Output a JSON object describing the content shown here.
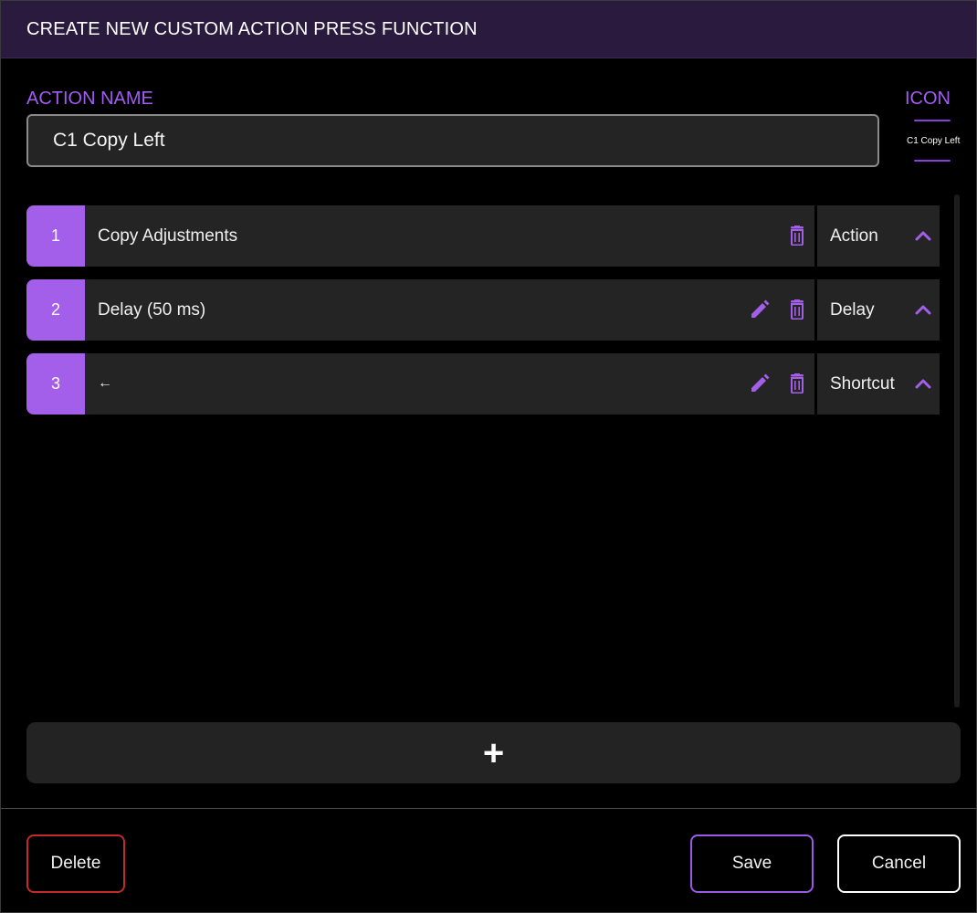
{
  "title": "CREATE NEW CUSTOM ACTION PRESS FUNCTION",
  "action_name": {
    "label": "ACTION NAME",
    "value": "C1 Copy Left"
  },
  "icon": {
    "label": "ICON",
    "preview_text": "C1 Copy Left"
  },
  "steps": [
    {
      "number": "1",
      "text": "Copy Adjustments",
      "type": "Action",
      "editable": false
    },
    {
      "number": "2",
      "text": "Delay (50 ms)",
      "type": "Delay",
      "editable": true
    },
    {
      "number": "3",
      "text": "←",
      "type": "Shortcut",
      "editable": true
    }
  ],
  "add_button": {
    "label": "+"
  },
  "footer": {
    "delete_label": "Delete",
    "save_label": "Save",
    "cancel_label": "Cancel"
  },
  "colors": {
    "accent": "#a45fea",
    "title_bar": "#2a1a3e",
    "row_bg": "#242424",
    "delete_border": "#c42a2a"
  },
  "icons": {
    "edit": "pencil-icon",
    "delete": "trash-icon",
    "expand": "chevron-up-icon"
  }
}
